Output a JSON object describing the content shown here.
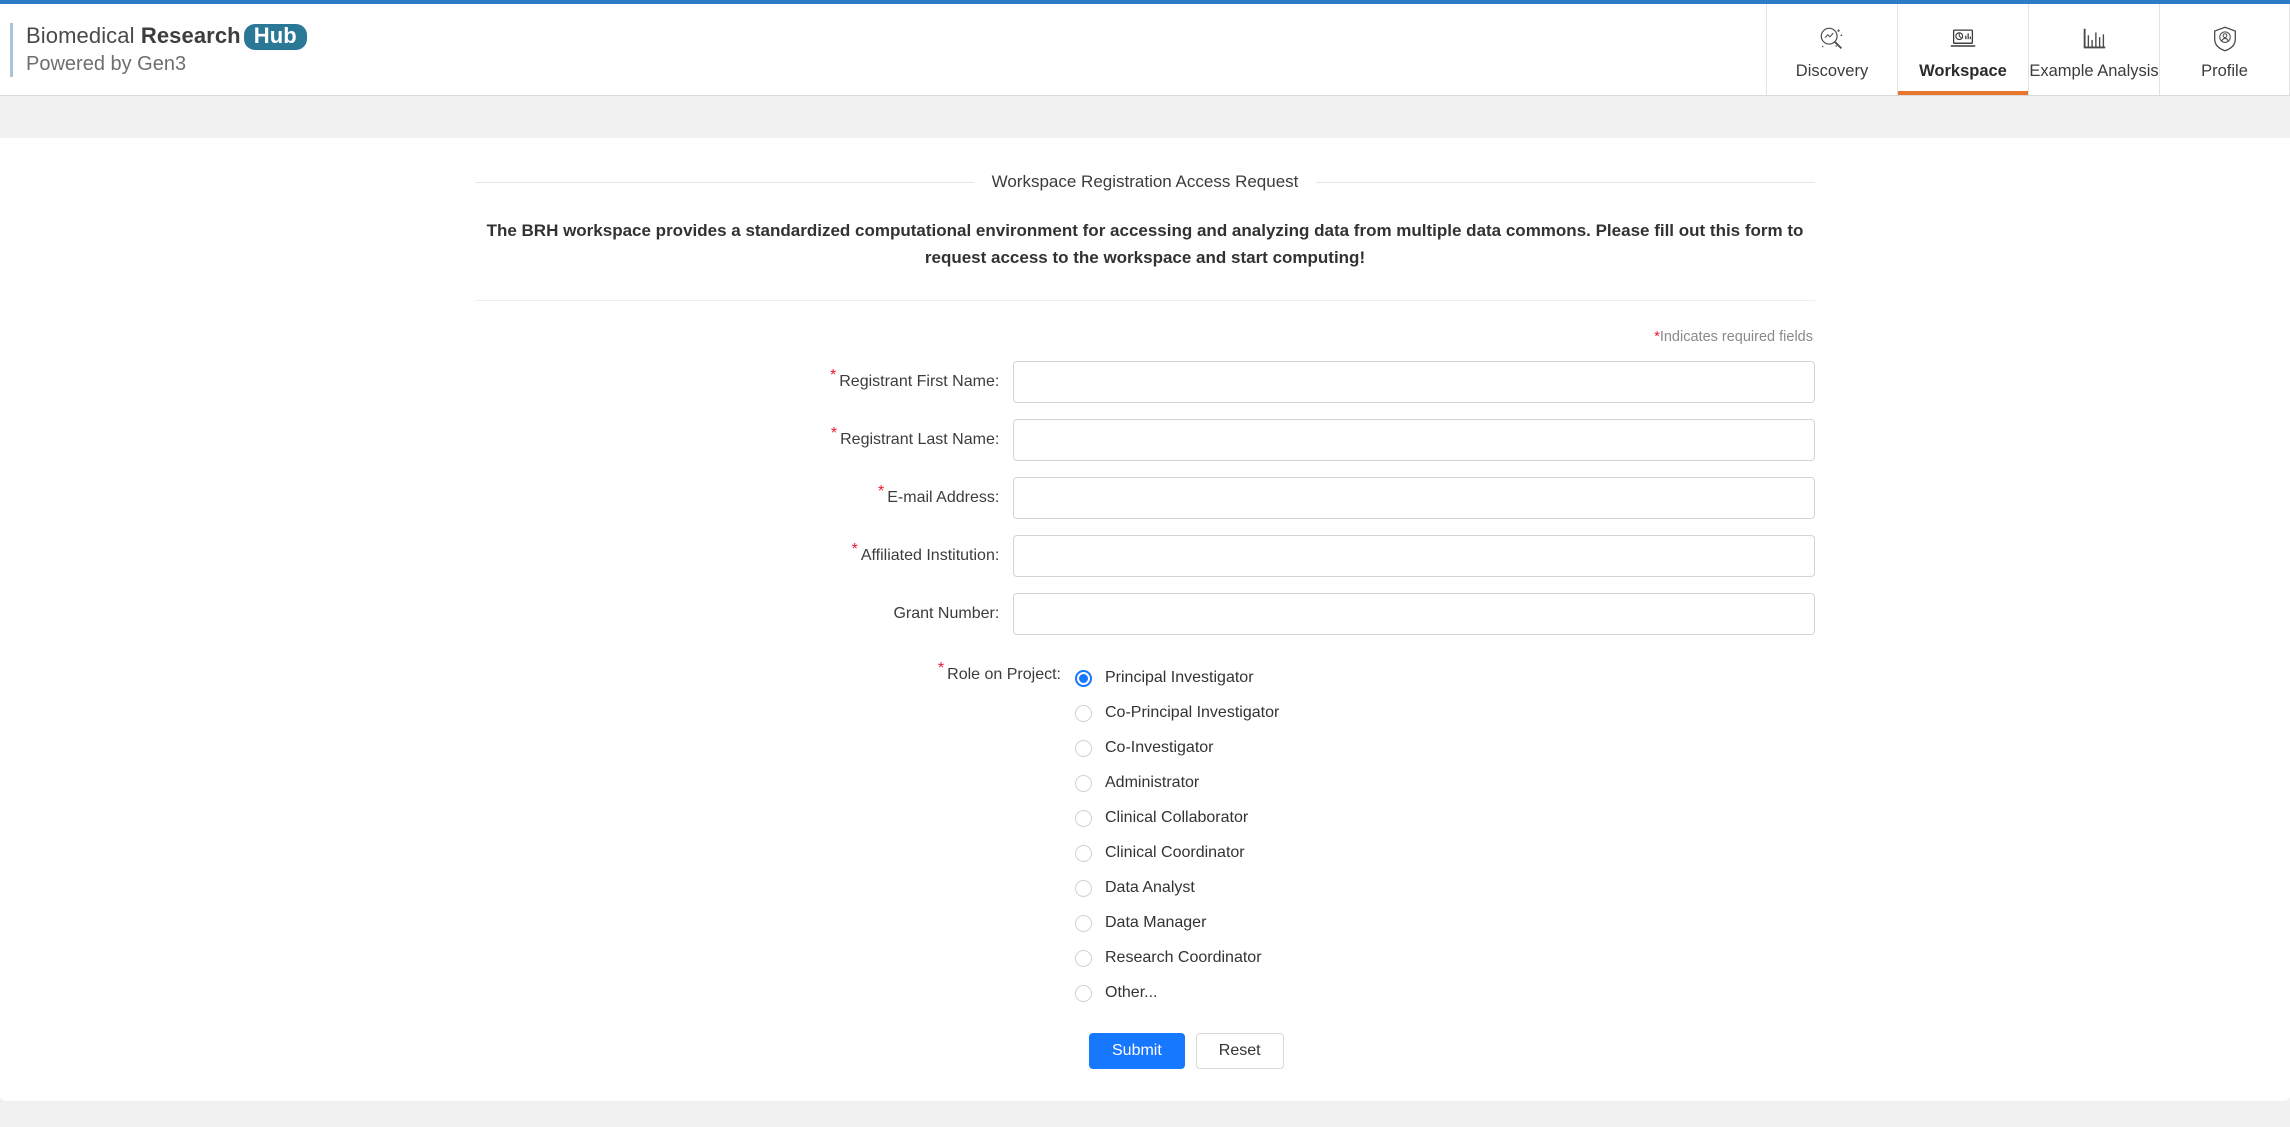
{
  "brand": {
    "line1_regular": "Biomedical ",
    "line1_bold": "Research",
    "hub_badge": "Hub",
    "line2": "Powered by Gen3",
    "accent_teal": "#2a7796",
    "accent_blue": "#2b7cc4"
  },
  "nav": {
    "active_color": "#e8762c",
    "items": [
      {
        "label": "Discovery",
        "icon": "discovery-magnifier-icon",
        "active": false
      },
      {
        "label": "Workspace",
        "icon": "workspace-laptop-icon",
        "active": true
      },
      {
        "label": "Example Analysis",
        "icon": "bar-chart-icon",
        "active": false
      },
      {
        "label": "Profile",
        "icon": "shield-person-icon",
        "active": false
      }
    ]
  },
  "form": {
    "legend_title": "Workspace Registration Access Request",
    "description": "The BRH workspace provides a standardized computational environment for accessing and analyzing data from multiple data commons. Please fill out this form to request access to the workspace and start computing!",
    "required_note_star": "*",
    "required_note_text": "Indicates required fields",
    "required_star_color": "#e8192c",
    "fields": [
      {
        "label": "Registrant First Name",
        "required": true,
        "value": "",
        "placeholder": ""
      },
      {
        "label": "Registrant Last Name",
        "required": true,
        "value": "",
        "placeholder": ""
      },
      {
        "label": "E-mail Address",
        "required": true,
        "value": "",
        "placeholder": ""
      },
      {
        "label": "Affiliated Institution",
        "required": true,
        "value": "",
        "placeholder": ""
      },
      {
        "label": "Grant Number",
        "required": false,
        "value": "",
        "placeholder": ""
      }
    ],
    "role_group": {
      "label": "Role on Project",
      "required": true,
      "selected_index": 0,
      "selected_color": "#1677ff",
      "options": [
        "Principal Investigator",
        "Co-Principal Investigator",
        "Co-Investigator",
        "Administrator",
        "Clinical Collaborator",
        "Clinical Coordinator",
        "Data Analyst",
        "Data Manager",
        "Research Coordinator",
        "Other..."
      ]
    },
    "buttons": {
      "submit_label": "Submit",
      "reset_label": "Reset",
      "submit_color": "#1677ff"
    },
    "label_colon": ":"
  }
}
